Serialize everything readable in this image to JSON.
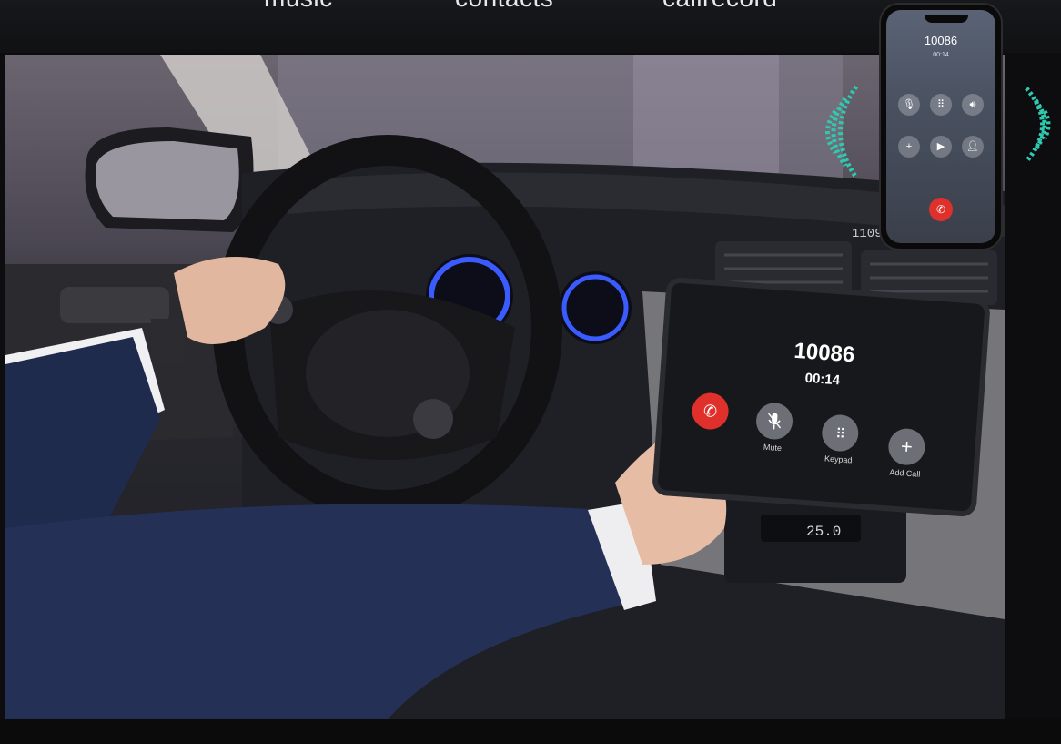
{
  "header": {
    "labels": [
      "music",
      "contacts",
      "callrecord"
    ]
  },
  "head_unit": {
    "number": "10086",
    "timer": "00:14",
    "buttons": [
      {
        "label": "Mute",
        "icon": "microphone-icon"
      },
      {
        "label": "Keypad",
        "icon": "keypad-icon"
      },
      {
        "label": "Add Call",
        "icon": "plus-icon"
      }
    ],
    "end_call_icon": "hang-up-icon"
  },
  "phone": {
    "number": "10086",
    "timer": "00:14",
    "buttons": [
      {
        "icon": "microphone-icon"
      },
      {
        "icon": "keypad-icon"
      },
      {
        "icon": "speaker-icon"
      },
      {
        "icon": "plus-icon"
      },
      {
        "icon": "video-icon"
      },
      {
        "icon": "contact-icon"
      }
    ],
    "end_call_icon": "hang-up-icon"
  },
  "dashboard": {
    "clock_readout": "1109",
    "climate_readout": "25.0"
  },
  "colors": {
    "end_call": "#e0302b",
    "wave": "#2fc9b0",
    "gauge": "#3a5cff"
  }
}
